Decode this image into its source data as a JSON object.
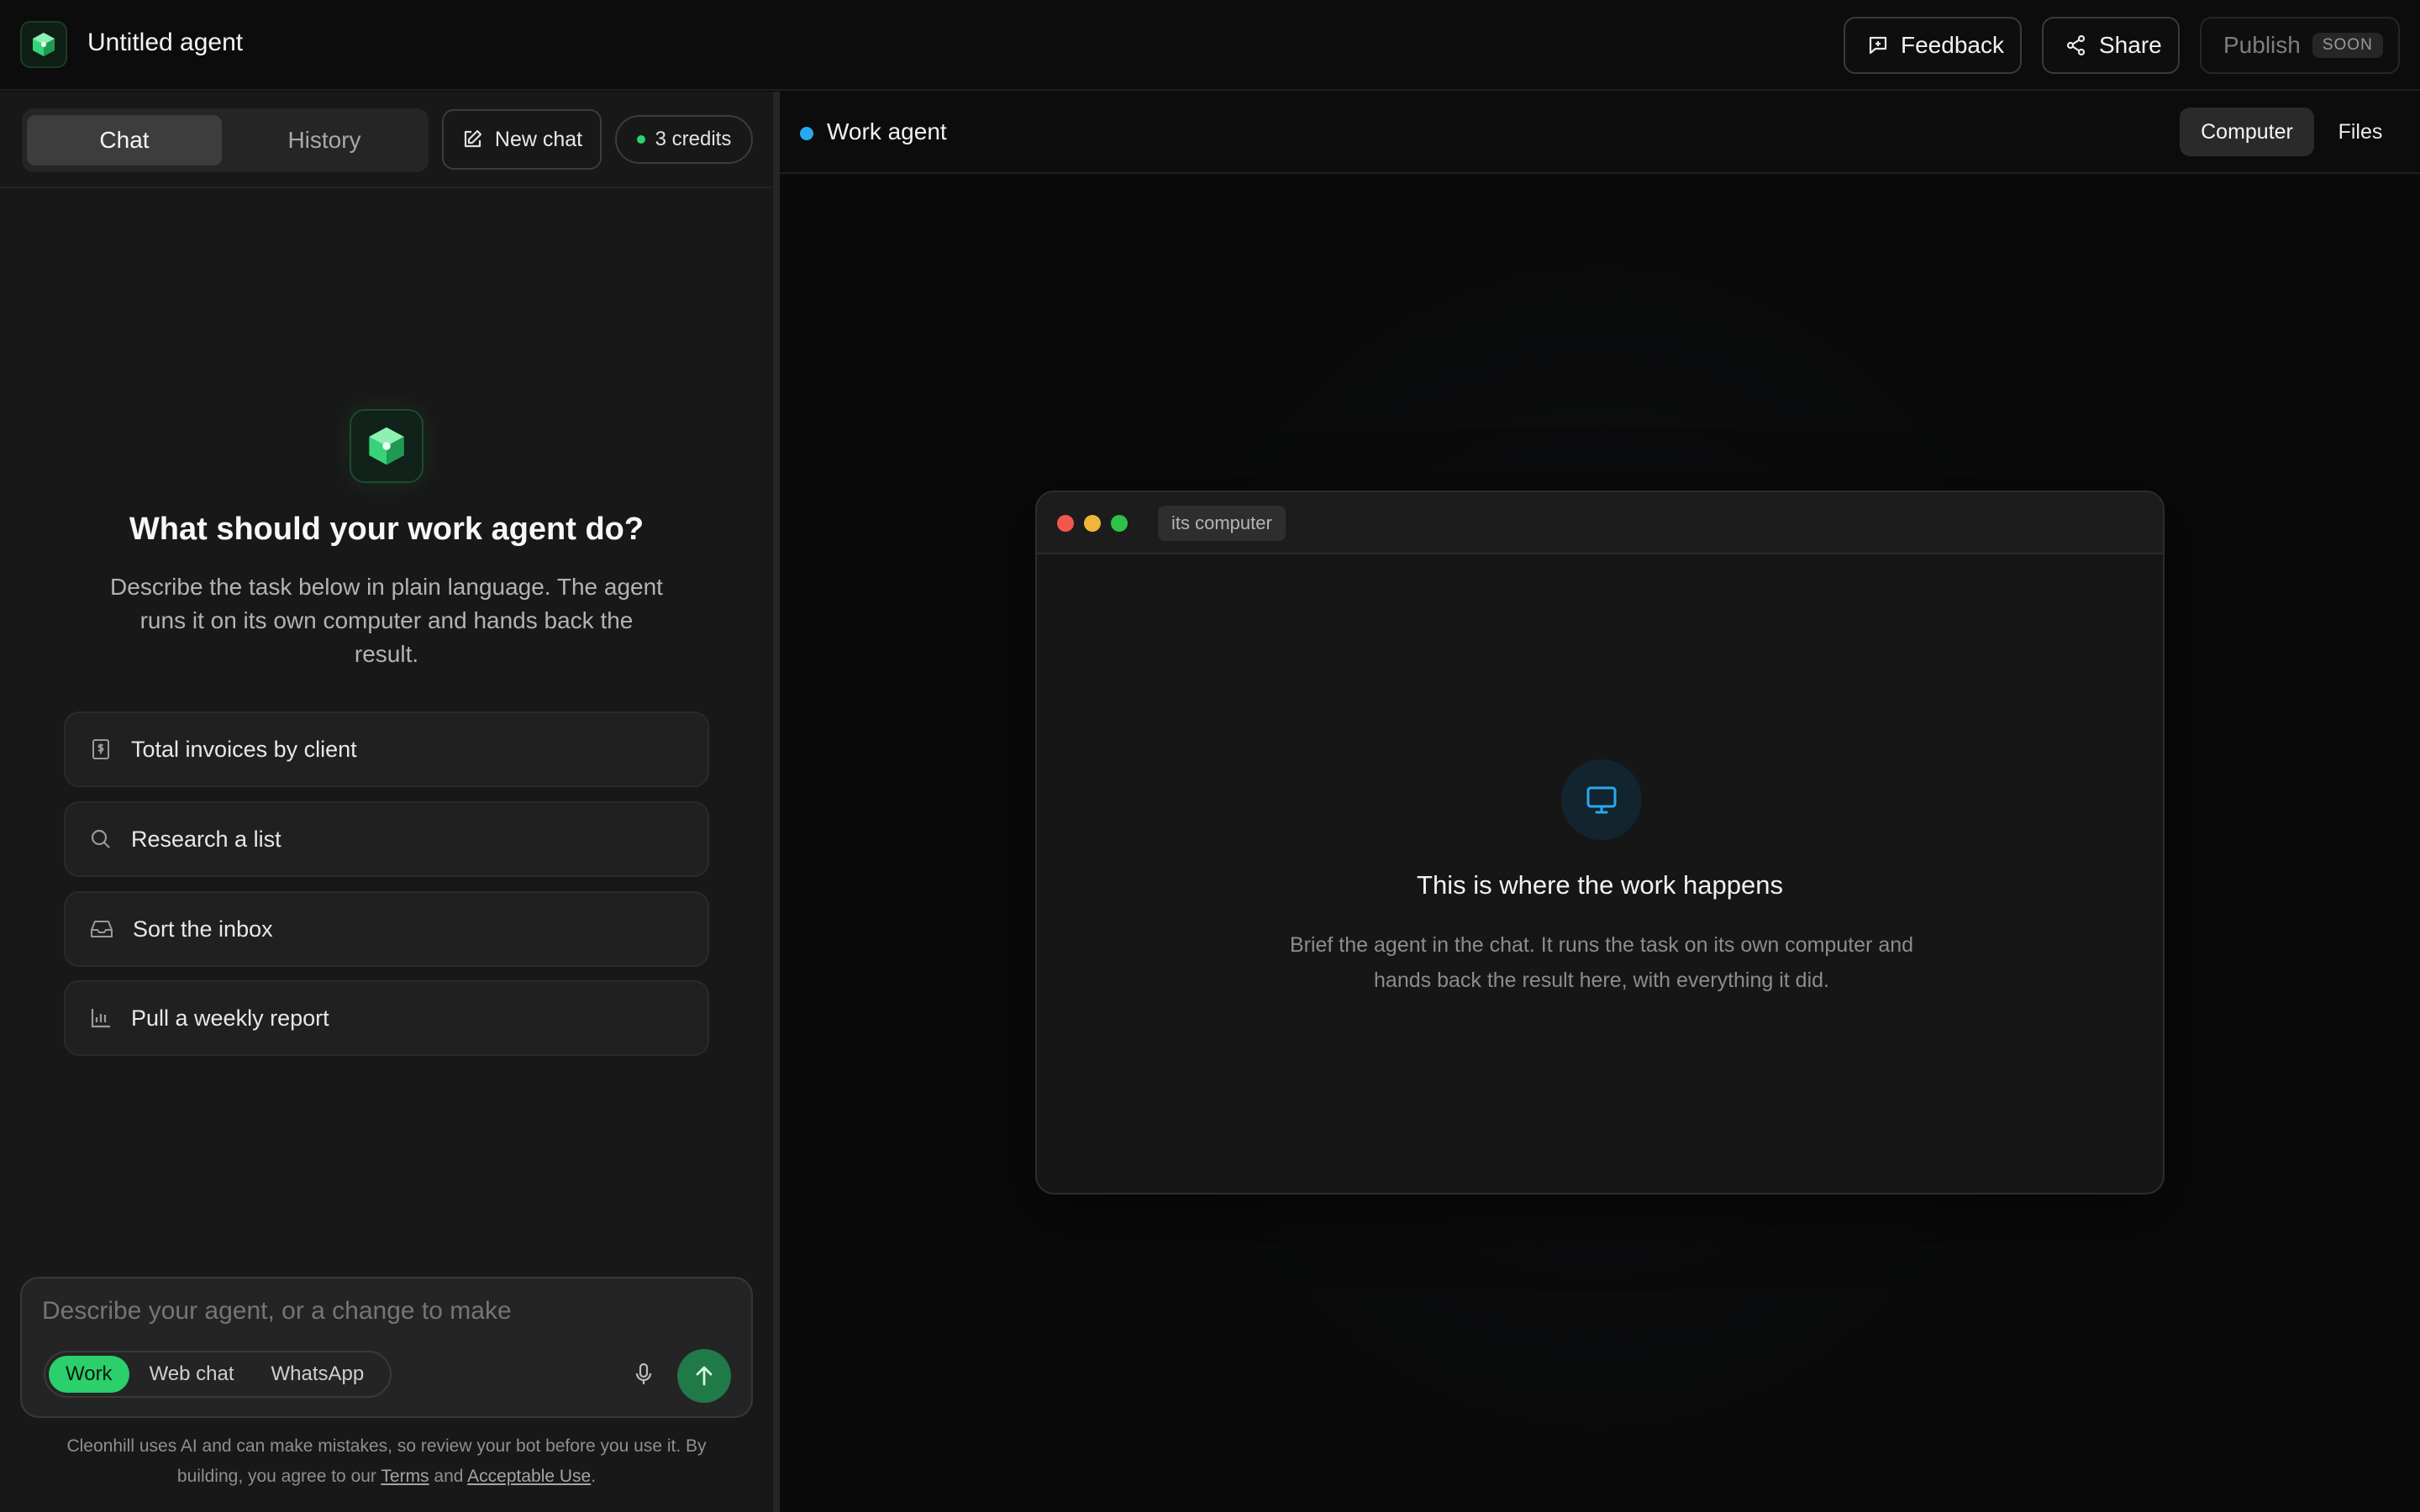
{
  "header": {
    "app_title": "Untitled agent",
    "feedback_label": "Feedback",
    "share_label": "Share",
    "publish_label": "Publish",
    "publish_badge": "SOON"
  },
  "left_panel": {
    "tabs": [
      {
        "label": "Chat",
        "active": true
      },
      {
        "label": "History",
        "active": false
      }
    ],
    "new_chat_label": "New chat",
    "credits_label": "3 credits",
    "hero_title": "What should your work agent do?",
    "hero_subtitle": "Describe the task below in plain language. The agent runs it on its own computer and hands back the result.",
    "suggestions": [
      {
        "label": "Total invoices by client",
        "icon": "invoice-icon"
      },
      {
        "label": "Research a list",
        "icon": "search-icon"
      },
      {
        "label": "Sort the inbox",
        "icon": "inbox-icon"
      },
      {
        "label": "Pull a weekly report",
        "icon": "bar-chart-icon"
      }
    ],
    "composer": {
      "placeholder": "Describe your agent, or a change to make",
      "modes": [
        {
          "label": "Work",
          "active": true
        },
        {
          "label": "Web chat",
          "active": false
        },
        {
          "label": "WhatsApp",
          "active": false
        }
      ]
    },
    "disclaimer": {
      "prefix": "Cleonhill uses AI and can make mistakes, so review your bot before you use it. By building, you agree to our",
      "terms": "Terms",
      "and": "and",
      "acceptable_use": "Acceptable Use",
      "suffix": "."
    }
  },
  "right_panel": {
    "agent_name": "Work agent",
    "view_tabs": [
      {
        "label": "Computer",
        "active": true
      },
      {
        "label": "Files",
        "active": false
      }
    ],
    "window": {
      "tag": "its computer",
      "title": "This is where the work happens",
      "subtitle": "Brief the agent in the chat. It runs the task on its own computer and hands back the result here, with everything it did."
    }
  },
  "colors": {
    "accent_green": "#2bcf6b",
    "send_button": "#1f7a45",
    "status_blue": "#27a8f0",
    "background": "#0a0a0a",
    "panel": "#181818"
  }
}
